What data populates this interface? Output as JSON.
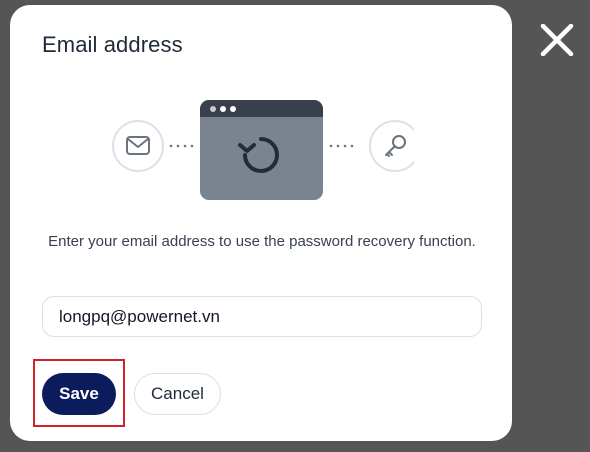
{
  "dialog": {
    "title": "Email address",
    "description": "Enter your email address to use the password recovery function.",
    "email_value": "longpq@powernet.vn",
    "save_label": "Save",
    "cancel_label": "Cancel"
  },
  "illustration": {
    "left_icon": "mail-icon",
    "center_icon": "browser-window-refresh-icon",
    "right_icon": "key-icon"
  },
  "colors": {
    "overlay": "#555555",
    "primary": "#0c1b5c",
    "highlight": "#d0202a",
    "window_body": "#7a8390",
    "window_bar": "#3a404b"
  }
}
